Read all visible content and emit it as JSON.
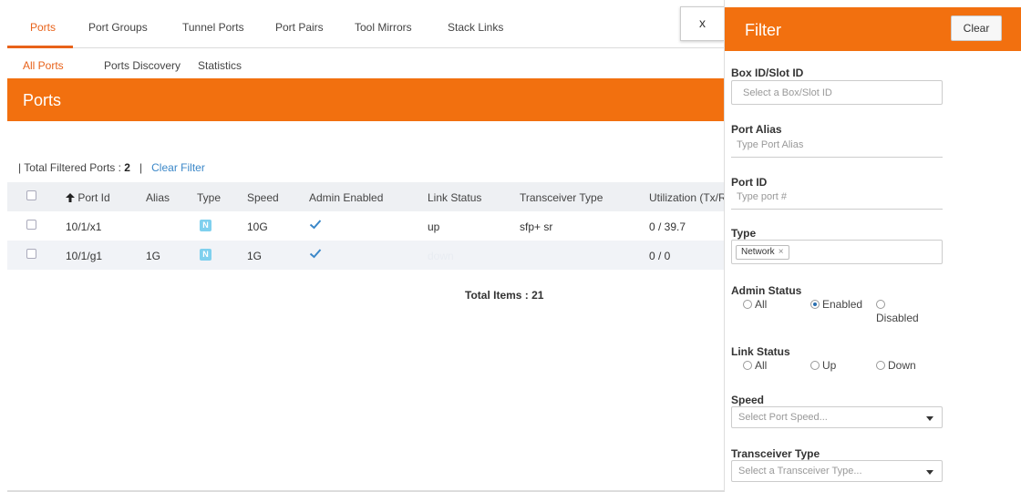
{
  "tabs": [
    {
      "label": "Ports"
    },
    {
      "label": "Port Groups"
    },
    {
      "label": "Tunnel Ports"
    },
    {
      "label": "Port Pairs"
    },
    {
      "label": "Tool Mirrors"
    },
    {
      "label": "Stack Links"
    }
  ],
  "subtabs": [
    {
      "label": "All Ports"
    },
    {
      "label": "Ports Discovery"
    },
    {
      "label": "Statistics"
    }
  ],
  "page_title": "Ports",
  "summary": {
    "prefix": "| Total Filtered Ports :",
    "count": "2",
    "separator": "|",
    "clear_filter": "Clear Filter"
  },
  "table": {
    "headers": [
      "Port Id",
      "Alias",
      "Type",
      "Speed",
      "Admin Enabled",
      "Link Status",
      "Transceiver Type",
      "Utilization (Tx/R"
    ],
    "sort_icon": "arrow-up-icon",
    "rows": [
      {
        "port_id": "10/1/x1",
        "alias": "",
        "type": "N",
        "speed": "10G",
        "admin_enabled": "check-icon",
        "link_status": "up",
        "transceiver": "sfp+ sr",
        "utilization": "0 / 39.7"
      },
      {
        "port_id": "10/1/g1",
        "alias": "1G",
        "type": "N",
        "speed": "1G",
        "admin_enabled": "check-icon",
        "link_status": "down",
        "transceiver": "",
        "utilization": "0 / 0"
      }
    ]
  },
  "total_items": "Total Items : 21",
  "close_label": "x",
  "filter": {
    "title": "Filter",
    "clear_label": "Clear",
    "box_slot": {
      "label": "Box ID/Slot ID",
      "placeholder": "Select a Box/Slot ID"
    },
    "port_alias": {
      "label": "Port Alias",
      "placeholder": "Type Port Alias"
    },
    "port_id": {
      "label": "Port ID",
      "placeholder": "Type port #"
    },
    "type": {
      "label": "Type",
      "tag": "Network",
      "tag_remove": "×"
    },
    "admin_status": {
      "label": "Admin Status",
      "options": [
        "All",
        "Enabled",
        "Disabled"
      ],
      "selected": "Enabled"
    },
    "link_status": {
      "label": "Link Status",
      "options": [
        "All",
        "Up",
        "Down"
      ],
      "selected": ""
    },
    "speed": {
      "label": "Speed",
      "placeholder": "Select Port Speed..."
    },
    "transceiver": {
      "label": "Transceiver Type",
      "placeholder": "Select a Transceiver Type..."
    }
  },
  "colors": {
    "accent": "#f2700f",
    "active_tab": "#e8621a",
    "link": "#3a87c8",
    "badge": "#7fd0ee"
  }
}
